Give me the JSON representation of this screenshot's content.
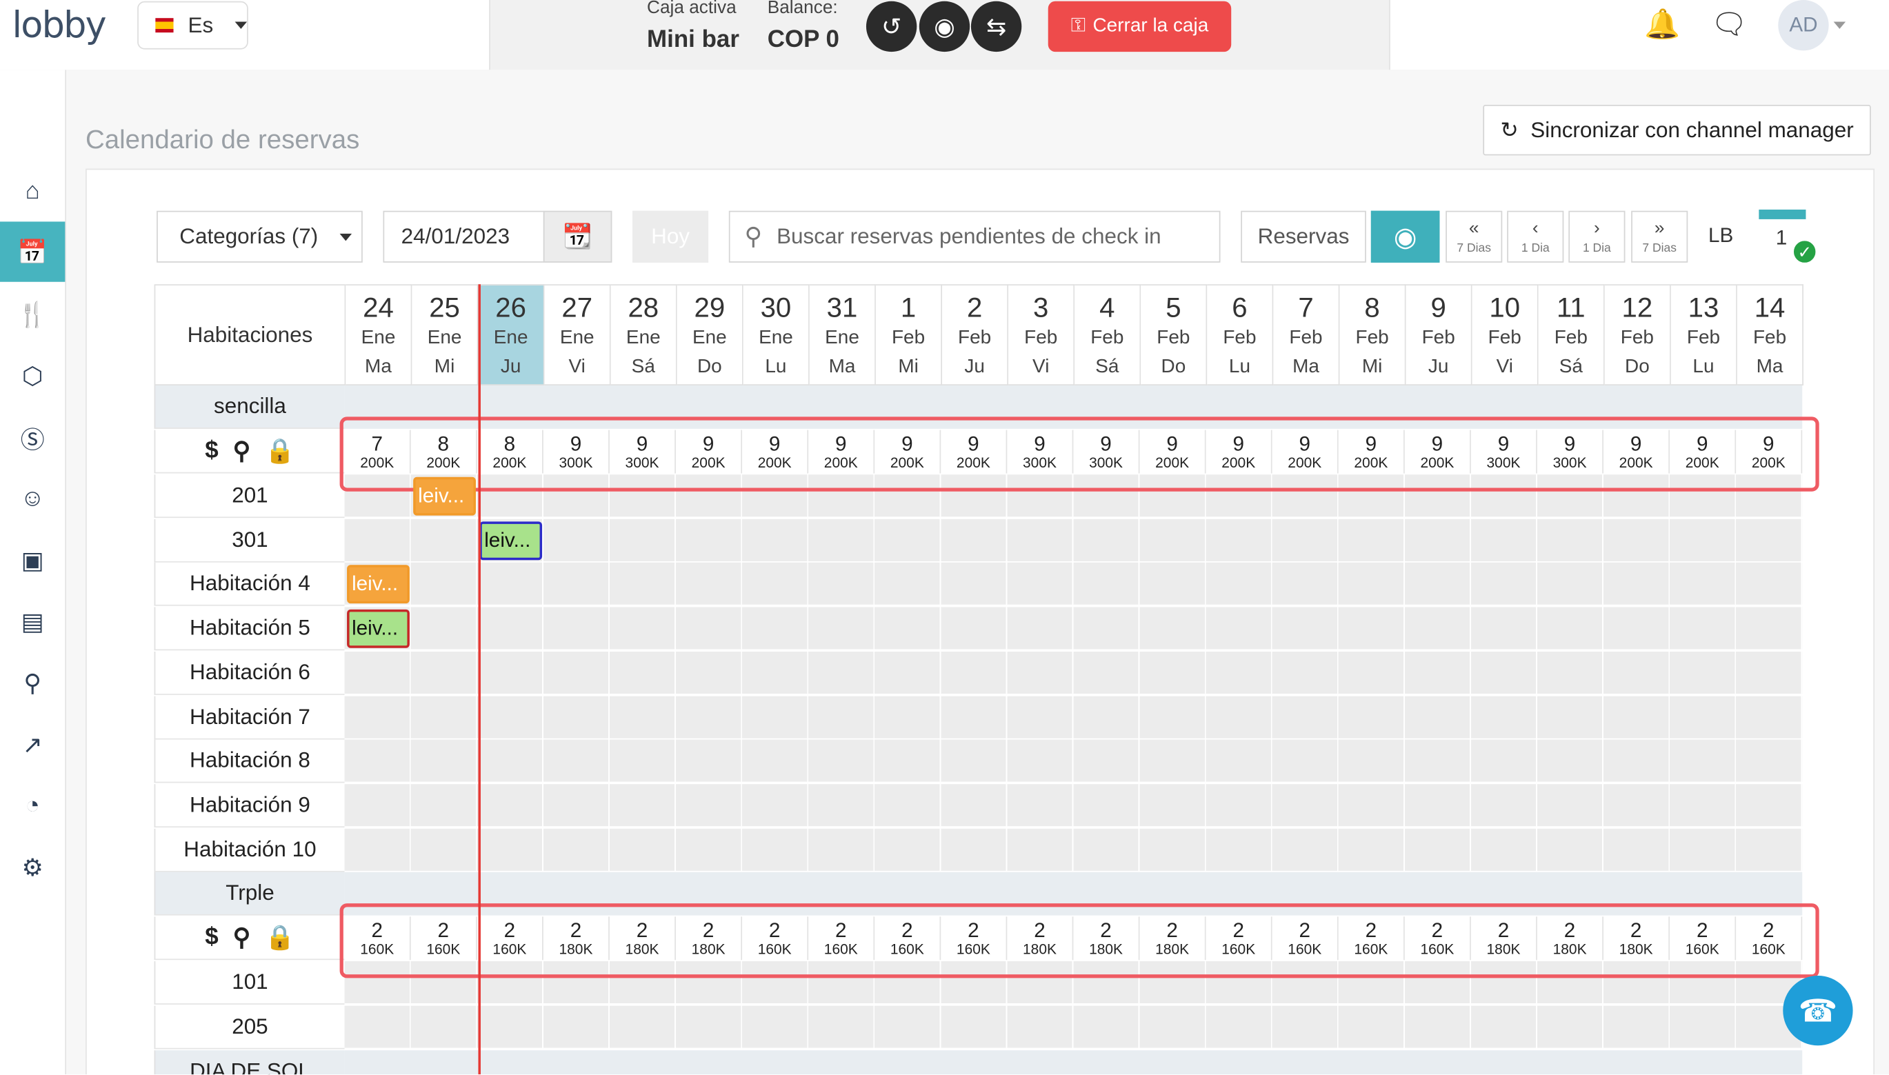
{
  "header": {
    "logo": "lobby",
    "language": "Es",
    "caja_label": "Caja activa",
    "caja_value": "Mini bar",
    "balance_label": "Balance:",
    "balance_value": "COP 0",
    "close_button": "Cerrar la caja",
    "avatar": "AD"
  },
  "page": {
    "title": "Calendario de reservas",
    "sync_button": "Sincronizar con channel manager"
  },
  "filters": {
    "categories": "Categorías (7)",
    "date": "24/01/2023",
    "today_button": "Hoy",
    "search_placeholder": "Buscar reservas pendientes de check in",
    "reservas_button": "Reservas",
    "nav": [
      {
        "glyph": "«",
        "label": "7 Dias"
      },
      {
        "glyph": "‹",
        "label": "1 Dia"
      },
      {
        "glyph": "›",
        "label": "1 Dia"
      },
      {
        "glyph": "»",
        "label": "7 Dias"
      }
    ],
    "lb": "LB",
    "notif_count": "1"
  },
  "calendar": {
    "rooms_header": "Habitaciones",
    "days": [
      {
        "n": "24",
        "m": "Ene",
        "d": "Ma"
      },
      {
        "n": "25",
        "m": "Ene",
        "d": "Mi"
      },
      {
        "n": "26",
        "m": "Ene",
        "d": "Ju",
        "today": true
      },
      {
        "n": "27",
        "m": "Ene",
        "d": "Vi"
      },
      {
        "n": "28",
        "m": "Ene",
        "d": "Sá"
      },
      {
        "n": "29",
        "m": "Ene",
        "d": "Do"
      },
      {
        "n": "30",
        "m": "Ene",
        "d": "Lu"
      },
      {
        "n": "31",
        "m": "Ene",
        "d": "Ma"
      },
      {
        "n": "1",
        "m": "Feb",
        "d": "Mi"
      },
      {
        "n": "2",
        "m": "Feb",
        "d": "Ju"
      },
      {
        "n": "3",
        "m": "Feb",
        "d": "Vi"
      },
      {
        "n": "4",
        "m": "Feb",
        "d": "Sá"
      },
      {
        "n": "5",
        "m": "Feb",
        "d": "Do"
      },
      {
        "n": "6",
        "m": "Feb",
        "d": "Lu"
      },
      {
        "n": "7",
        "m": "Feb",
        "d": "Ma"
      },
      {
        "n": "8",
        "m": "Feb",
        "d": "Mi"
      },
      {
        "n": "9",
        "m": "Feb",
        "d": "Ju"
      },
      {
        "n": "10",
        "m": "Feb",
        "d": "Vi"
      },
      {
        "n": "11",
        "m": "Feb",
        "d": "Sá"
      },
      {
        "n": "12",
        "m": "Feb",
        "d": "Do"
      },
      {
        "n": "13",
        "m": "Feb",
        "d": "Lu"
      },
      {
        "n": "14",
        "m": "Feb",
        "d": "Ma"
      }
    ],
    "categories": [
      {
        "name": "sencilla",
        "availability": [
          {
            "c": "7",
            "p": "200K"
          },
          {
            "c": "8",
            "p": "200K"
          },
          {
            "c": "8",
            "p": "200K"
          },
          {
            "c": "9",
            "p": "300K"
          },
          {
            "c": "9",
            "p": "300K"
          },
          {
            "c": "9",
            "p": "200K"
          },
          {
            "c": "9",
            "p": "200K"
          },
          {
            "c": "9",
            "p": "200K"
          },
          {
            "c": "9",
            "p": "200K"
          },
          {
            "c": "9",
            "p": "200K"
          },
          {
            "c": "9",
            "p": "300K"
          },
          {
            "c": "9",
            "p": "300K"
          },
          {
            "c": "9",
            "p": "200K"
          },
          {
            "c": "9",
            "p": "200K"
          },
          {
            "c": "9",
            "p": "200K"
          },
          {
            "c": "9",
            "p": "200K"
          },
          {
            "c": "9",
            "p": "200K"
          },
          {
            "c": "9",
            "p": "300K"
          },
          {
            "c": "9",
            "p": "300K"
          },
          {
            "c": "9",
            "p": "200K"
          },
          {
            "c": "9",
            "p": "200K"
          },
          {
            "c": "9",
            "p": "200K"
          }
        ],
        "rooms": [
          "201",
          "301",
          "Habitación 4",
          "Habitación 5",
          "Habitación 6",
          "Habitación 7",
          "Habitación 8",
          "Habitación 9",
          "Habitación 10"
        ]
      },
      {
        "name": "Trple",
        "availability": [
          {
            "c": "2",
            "p": "160K"
          },
          {
            "c": "2",
            "p": "160K"
          },
          {
            "c": "2",
            "p": "160K"
          },
          {
            "c": "2",
            "p": "180K"
          },
          {
            "c": "2",
            "p": "180K"
          },
          {
            "c": "2",
            "p": "180K"
          },
          {
            "c": "2",
            "p": "160K"
          },
          {
            "c": "2",
            "p": "160K"
          },
          {
            "c": "2",
            "p": "160K"
          },
          {
            "c": "2",
            "p": "160K"
          },
          {
            "c": "2",
            "p": "180K"
          },
          {
            "c": "2",
            "p": "180K"
          },
          {
            "c": "2",
            "p": "180K"
          },
          {
            "c": "2",
            "p": "160K"
          },
          {
            "c": "2",
            "p": "160K"
          },
          {
            "c": "2",
            "p": "160K"
          },
          {
            "c": "2",
            "p": "160K"
          },
          {
            "c": "2",
            "p": "180K"
          },
          {
            "c": "2",
            "p": "180K"
          },
          {
            "c": "2",
            "p": "180K"
          },
          {
            "c": "2",
            "p": "160K"
          },
          {
            "c": "2",
            "p": "160K"
          }
        ],
        "rooms": [
          "101",
          "205"
        ]
      }
    ],
    "next_category": "DIA DE SOL",
    "bookings": [
      {
        "label": "leiv...",
        "room": "201",
        "day": 1,
        "status": "orange"
      },
      {
        "label": "leiv...",
        "room": "301",
        "day": 2,
        "status": "green-blue"
      },
      {
        "label": "leiv...",
        "room": "Habitación 4",
        "day": 0,
        "status": "orange"
      },
      {
        "label": "leiv...",
        "room": "Habitación 5",
        "day": 0,
        "status": "green-red"
      }
    ]
  },
  "colors": {
    "accent": "#3fb0bb",
    "danger": "#ee4b4b",
    "today": "#a8d5e0",
    "highlight": "#ef5b63"
  }
}
